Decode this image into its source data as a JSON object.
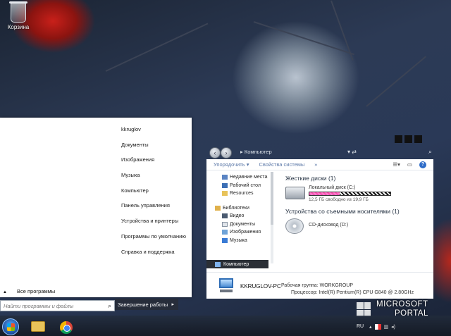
{
  "desktop": {
    "recycle_bin_label": "Корзина"
  },
  "start_menu": {
    "right_items": [
      "kkruglov",
      "Документы",
      "Изображения",
      "Музыка",
      "Компьютер",
      "Панель управления",
      "Устройства и принтеры",
      "Программы по умолчанию",
      "Справка и поддержка"
    ],
    "all_programs": "Все программы",
    "all_programs_arrow": "▲",
    "search_placeholder": "Найти программы и файлы",
    "shutdown_label": "Завершение работы"
  },
  "explorer": {
    "address": "Компьютер",
    "toolbar": {
      "organize": "Упорядочить ▾",
      "properties": "Свойства системы",
      "more": "»"
    },
    "nav": {
      "favorites": [
        "Недавние места",
        "Рабочий стол",
        "Resources"
      ],
      "libraries_header": "Библиотеки",
      "libraries": [
        "Видео",
        "Документы",
        "Изображения",
        "Музыка"
      ],
      "computer": "Компьютер"
    },
    "hard_drives_header": "Жесткие диски (1)",
    "drive_c": {
      "name": "Локальный диск (C:)",
      "free_text": "12,5 ГБ свободно из 19,9 ГБ",
      "used_fraction": 0.37
    },
    "removable_header": "Устройства со съемными носителями (1)",
    "drive_d": {
      "name": "CD-дисковод (D:)"
    },
    "details": {
      "pc_name": "KKRUGLOV-PC",
      "workgroup": "Рабочая группа: WORKGROUP",
      "cpu": "Процессор: Intel(R) Pentium(R) CPU G840 @ 2.80GHz"
    }
  },
  "taskbar": {
    "language": "RU"
  },
  "watermark": {
    "line1": "MICROSOFT",
    "line2": "PORTAL"
  },
  "colors": {
    "selection": "#2b2f36",
    "link": "#5c79a8",
    "disk_fill": "#ff4fb3"
  }
}
